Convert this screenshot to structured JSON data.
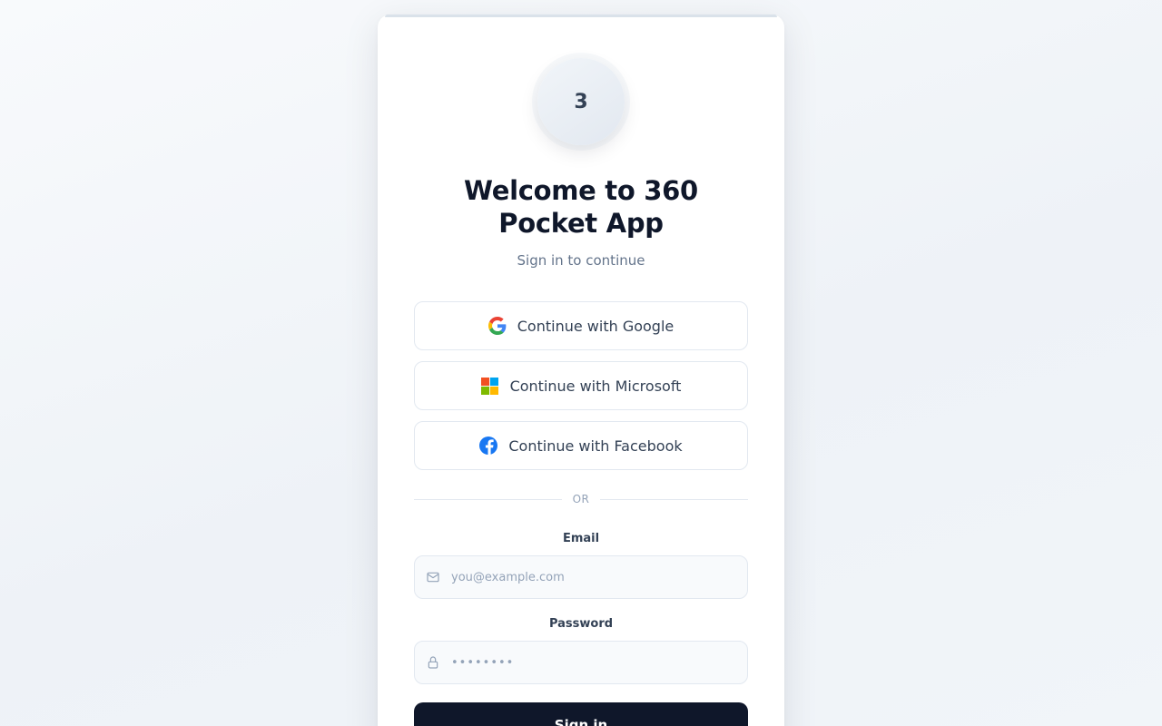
{
  "brand": {
    "logo_text": "3"
  },
  "header": {
    "title": "Welcome to 360 Pocket App",
    "subtitle": "Sign in to continue"
  },
  "social": {
    "google_label": "Continue with Google",
    "microsoft_label": "Continue with Microsoft",
    "facebook_label": "Continue with Facebook"
  },
  "divider": {
    "text": "OR"
  },
  "form": {
    "email_label": "Email",
    "email_placeholder": "you@example.com",
    "password_label": "Password",
    "password_placeholder": "••••••••",
    "submit_label": "Sign in"
  },
  "colors": {
    "primary": "#0f172a",
    "google_blue": "#4285F4",
    "google_red": "#EA4335",
    "google_yellow": "#FBBC05",
    "google_green": "#34A853",
    "ms_red": "#F25022",
    "ms_green": "#7FBA00",
    "ms_blue": "#00A4EF",
    "ms_yellow": "#FFB900",
    "facebook_blue": "#1877F2"
  },
  "icons": [
    "google-logo-icon",
    "microsoft-logo-icon",
    "facebook-logo-icon",
    "mail-icon",
    "lock-icon"
  ]
}
